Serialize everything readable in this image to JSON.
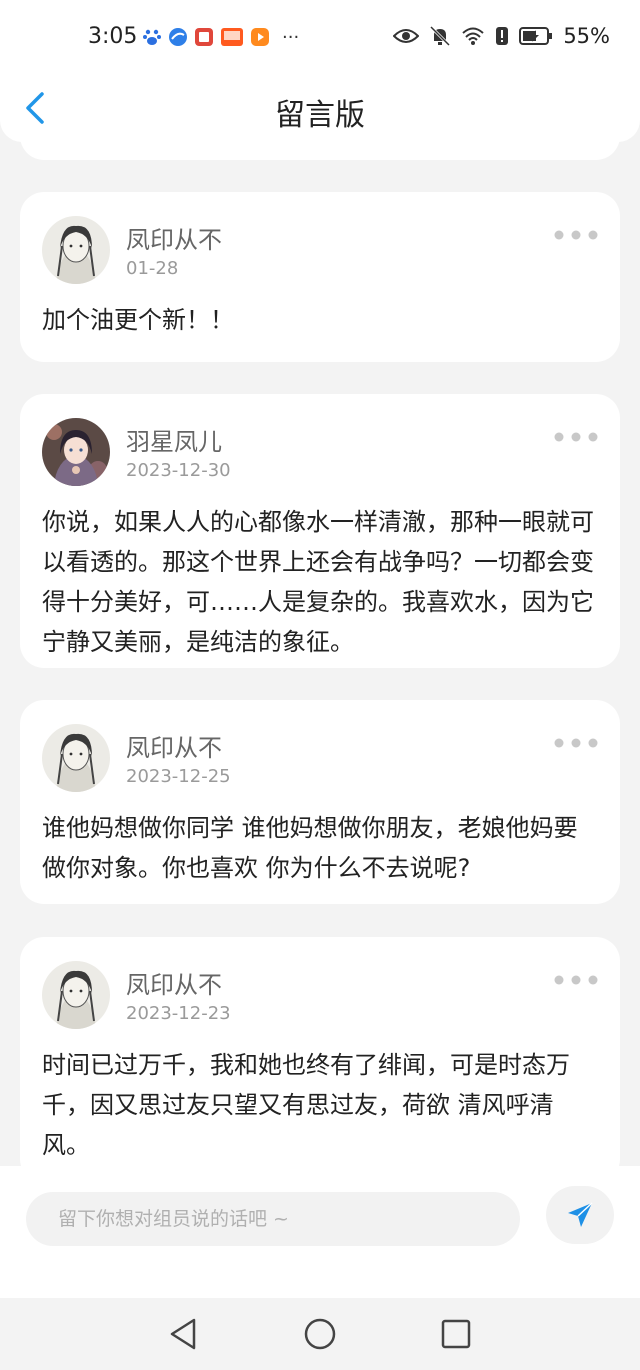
{
  "status_bar": {
    "time": "3:05",
    "more": "···",
    "battery": "55%",
    "icons": [
      "baidu-icon",
      "browser-icon",
      "books-icon",
      "taobao-icon",
      "video-icon",
      "eye-icon",
      "mute-bell-icon",
      "wifi-icon",
      "alert-icon",
      "battery-icon"
    ]
  },
  "header": {
    "title": "留言版",
    "back_icon": "chevron-left-icon"
  },
  "comments": [
    {
      "author": "凤印从不",
      "date": "01-28",
      "content": "加个油更个新！！",
      "avatar": "avatar-sketch-girl"
    },
    {
      "author": "羽星凤儿",
      "date": "2023-12-30",
      "content": "你说，如果人人的心都像水一样清澈，那种一眼就可以看透的。那这个世界上还会有战争吗？一切都会变得十分美好，可……人是复杂的。我喜欢水，因为它宁静又美丽，是纯洁的象征。",
      "avatar": "avatar-anime-girl"
    },
    {
      "author": "凤印从不",
      "date": "2023-12-25",
      "content": "谁他妈想做你同学 谁他妈想做你朋友，老娘他妈要做你对象。你也喜欢 你为什么不去说呢?",
      "avatar": "avatar-sketch-girl"
    },
    {
      "author": "凤印从不",
      "date": "2023-12-23",
      "content": "时间已过万千，我和她也终有了绯闻，可是时态万千，因又思过友只望又有思过友，荷欲 清风呼清风。",
      "avatar": "avatar-sketch-girl"
    }
  ],
  "input_bar": {
    "placeholder": "留下你想对组员说的话吧 ~",
    "send_icon": "send-icon"
  },
  "colors": {
    "accent": "#1e90e6",
    "background": "#f3f3f3",
    "card": "#ffffff"
  }
}
